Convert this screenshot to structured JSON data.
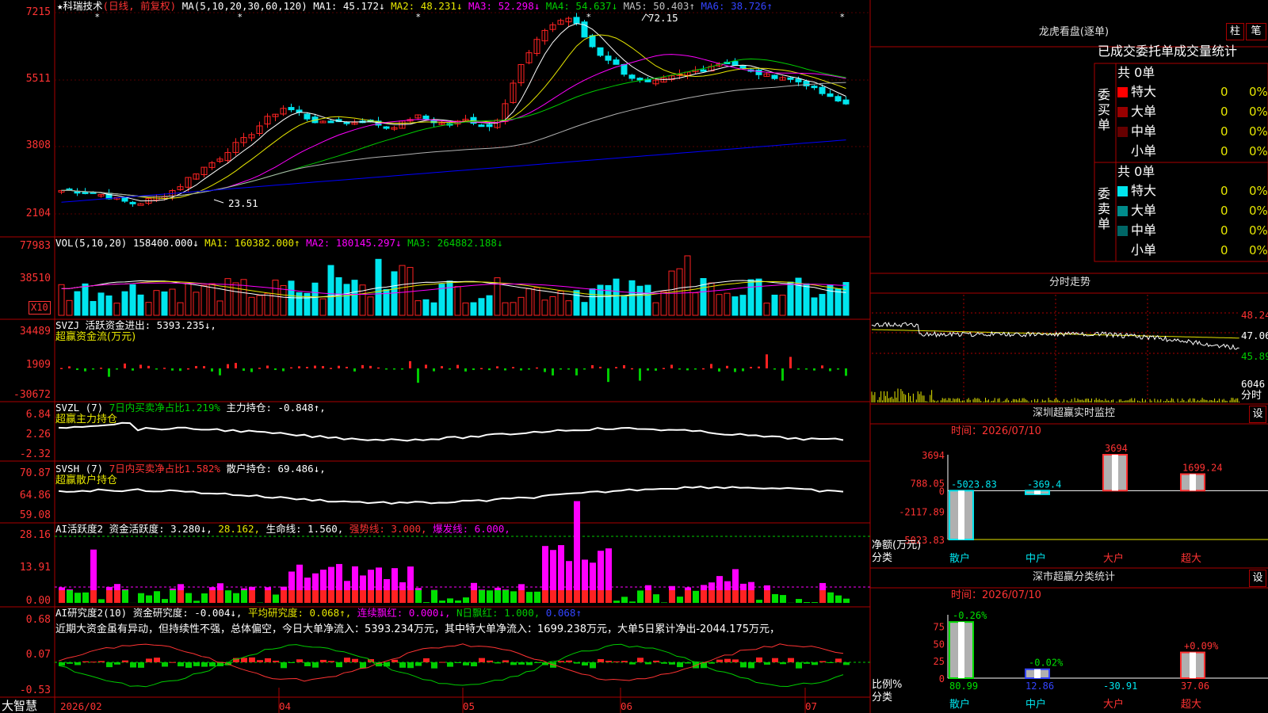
{
  "colors": {
    "up": "#ff2222",
    "down": "#00e5ee",
    "grid": "#aa0000",
    "ma1": "#ffffff",
    "ma2": "#e6e600",
    "ma3": "#ff00ff",
    "ma4": "#00cc00",
    "ma5": "#b0b0b0",
    "ma6": "#0000ff"
  },
  "header": {
    "star": "★",
    "stock_name": "科瑞技术",
    "mode": "(日线, 前复权)",
    "ma_params": "MA(5,10,20,30,60,120)",
    "ma1": "MA1: 45.172↓",
    "ma2": "MA2: 48.231↓",
    "ma3": "MA3: 52.298↓",
    "ma4": "MA4: 54.637↓",
    "ma5": "MA5: 50.403↑",
    "ma6": "MA6: 38.726↑"
  },
  "price_panel": {
    "y_ticks": [
      "7215",
      "5511",
      "3808",
      "2104"
    ],
    "high_label": "72.15",
    "low_label": "23.51"
  },
  "vol_panel": {
    "params": "VOL(5,10,20)",
    "vol": "158400.000↓",
    "ma1": "MA1: 160382.000↑",
    "ma2": "MA2: 180145.297↓",
    "ma3": "MA3: 264882.188↓",
    "y_ticks": [
      "77983",
      "38510"
    ],
    "unit": "X10"
  },
  "svzj_panel": {
    "line1": "SVZJ  活跃资金进出: 5393.235↓,",
    "line2": "超赢资金流(万元)",
    "y_ticks": [
      "34489",
      "1909",
      "-30672"
    ]
  },
  "svzl_panel": {
    "prefix": "SVZL (7)",
    "ratio": "7日内买卖净占比1.219%",
    "hold": "主力持仓: -0.848↑,",
    "line2": "超赢主力持仓",
    "y_ticks": [
      "6.84",
      "2.26",
      "-2.32"
    ]
  },
  "svsh_panel": {
    "prefix": "SVSH (7)",
    "ratio": "7日内买卖净占比1.582%",
    "hold": "散户持仓: 69.486↓,",
    "line2": "超赢散户持仓",
    "y_ticks": [
      "70.87",
      "64.86",
      "59.08"
    ]
  },
  "ai2_panel": {
    "a": "AI活跃度2 资金活跃度: 3.280↓,",
    "b": "28.162,",
    "c": "生命线: 1.560,",
    "d": "强势线: 3.000,",
    "e": "爆发线: 6.000,",
    "y_ticks": [
      "28.16",
      "13.91",
      "0.00"
    ]
  },
  "ai_res_panel": {
    "a": "AI研究度2(10) 资金研究度: -0.004↓,",
    "b": "平均研究度: 0.068↑,",
    "c": "连续飘红: 0.000↓,",
    "d": "N日飘红: 1.000,",
    "e": "0.068↑",
    "commentary": "近期大资金虽有异动，但持续性不强，总体偏空，今日大单净流入：5393.234万元，其中特大单净流入：1699.238万元，大单5日累计净出-2044.175万元，",
    "y_ticks": [
      "0.68",
      "0.07",
      "-0.53"
    ]
  },
  "x_axis": {
    "brand": "大智慧",
    "labels": [
      "2026/02",
      "04",
      "05",
      "06",
      "07"
    ]
  },
  "longhu": {
    "title": "龙虎看盘(逐单)",
    "btn1": "柱",
    "btn2": "笔",
    "stats_title": "已成交委托单成交量统计",
    "buy_label": "委买单",
    "sell_label": "委卖单",
    "buy_total": "共 0单",
    "sell_total": "共 0单",
    "buy_rows": [
      {
        "name": "特大",
        "count": "0",
        "pct": "0%",
        "color": "#ff0000"
      },
      {
        "name": "大单",
        "count": "0",
        "pct": "0%",
        "color": "#990000"
      },
      {
        "name": "中单",
        "count": "0",
        "pct": "0%",
        "color": "#660000"
      },
      {
        "name": "小单",
        "count": "0",
        "pct": "0%",
        "color": "#000000"
      }
    ],
    "sell_rows": [
      {
        "name": "特大",
        "count": "0",
        "pct": "0%",
        "color": "#00e5ee"
      },
      {
        "name": "大单",
        "count": "0",
        "pct": "0%",
        "color": "#008b8b"
      },
      {
        "name": "中单",
        "count": "0",
        "pct": "0%",
        "color": "#006666"
      },
      {
        "name": "小单",
        "count": "0",
        "pct": "0%",
        "color": "#000000"
      }
    ]
  },
  "intraday": {
    "title": "分时走势",
    "y_ticks": [
      "48.24",
      "47.06",
      "45.89"
    ],
    "vol_tick": "6046",
    "vol_unit": "分时"
  },
  "sz_monitor": {
    "title": "深圳超赢实时监控",
    "btn": "设",
    "time": "时间：2026/07/10",
    "y_ticks": [
      "3694",
      "788.05",
      "0",
      "-2117.89",
      "-5023.83"
    ],
    "ylabel1": "净额(万元)",
    "ylabel2": "分类",
    "cats": [
      "散户",
      "中户",
      "大户",
      "超大"
    ],
    "values": [
      -5023.83,
      -369.4,
      3694,
      1699.24
    ],
    "value_labels": [
      "-5023.83",
      "-369.4",
      "3694",
      "1699.24"
    ]
  },
  "sz_class": {
    "title": "深市超赢分类统计",
    "btn": "设",
    "time": "时间：2026/07/10",
    "y_ticks": [
      "75",
      "50",
      "25",
      "0"
    ],
    "ylabel1": "比例%",
    "ylabel2": "分类",
    "cats": [
      "散户",
      "中户",
      "大户",
      "超大"
    ],
    "bar_values": [
      80.99,
      12.86,
      -30.91,
      37.06
    ],
    "bar_labels": [
      "80.99",
      "12.86",
      "-30.91",
      "37.06"
    ],
    "change_labels": [
      "-0.26%",
      "-0.02%",
      "",
      "+0.09%"
    ]
  },
  "chart_data": {
    "type": "bar",
    "title": "深圳超赢实时监控",
    "ylabel": "净额(万元)",
    "categories": [
      "散户",
      "中户",
      "大户",
      "超大"
    ],
    "values": [
      -5023.83,
      -369.4,
      3694,
      1699.24
    ],
    "ylim": [
      -5023.83,
      3694
    ]
  }
}
